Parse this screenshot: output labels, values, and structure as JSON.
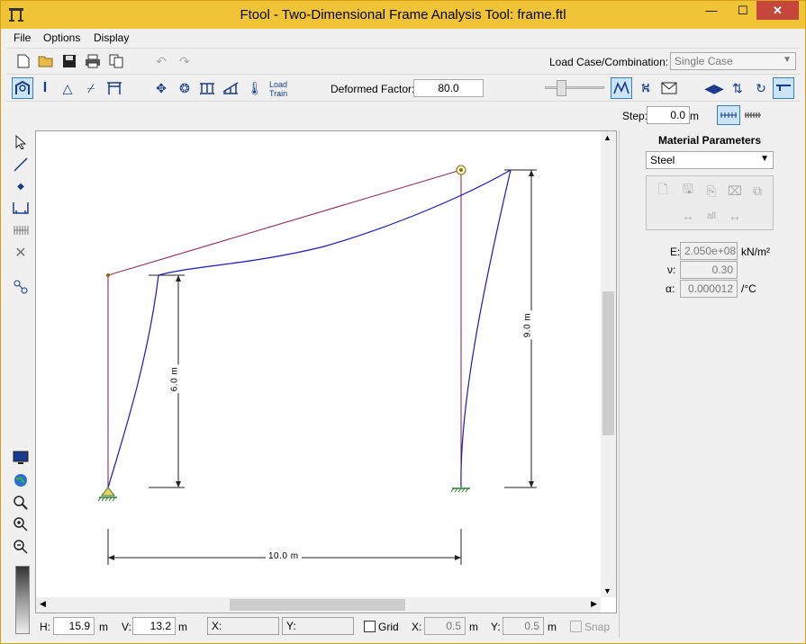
{
  "window": {
    "title": "Ftool - Two-Dimensional Frame Analysis Tool: frame.ftl",
    "minimize": "—",
    "maximize": "☐",
    "close": "✕"
  },
  "menu": [
    "File",
    "Options",
    "Display"
  ],
  "toolbar1": {
    "load_case_label": "Load Case/Combination:",
    "load_case_value": "Single Case"
  },
  "toolbar2": {
    "load_train_line1": "Load",
    "load_train_line2": "Train",
    "deformed_label": "Deformed Factor:",
    "deformed_value": "80.0"
  },
  "toolbar3": {
    "step_label": "Step:",
    "step_value": "0.0",
    "step_unit": "m"
  },
  "panel": {
    "title": "Material Parameters",
    "material": "Steel",
    "e_label": "E:",
    "e_value": "2.050e+08",
    "e_unit": "kN/m²",
    "nu_label": "ν:",
    "nu_value": "0.30",
    "alpha_label": "α:",
    "alpha_value": "0.000012",
    "alpha_unit": "/°C"
  },
  "drawing": {
    "dim_left": "6.0 m",
    "dim_right": "9.0 m",
    "dim_bottom": "10.0 m",
    "colors": {
      "frame": "#8b1a4a",
      "deformed": "#1a1ab8",
      "dimension": "#222222",
      "support": "#2e7d32"
    }
  },
  "status": {
    "h_label": "H:",
    "h_value": "15.9",
    "h_unit": "m",
    "v_label": "V:",
    "v_value": "13.2",
    "v_unit": "m",
    "x_coord": "X:",
    "y_coord": "Y:",
    "grid_label": "Grid",
    "gx_label": "X:",
    "gx_value": "0.5",
    "gx_unit": "m",
    "gy_label": "Y:",
    "gy_value": "0.5",
    "gy_unit": "m",
    "snap_label": "Snap"
  }
}
